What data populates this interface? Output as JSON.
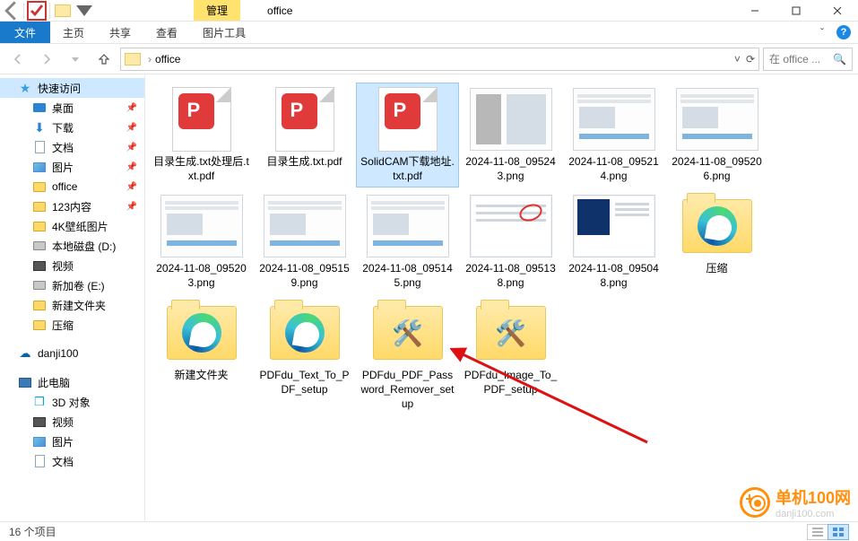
{
  "title_context_tab": "管理",
  "window_title": "office",
  "ribbon": {
    "file": "文件",
    "tabs": [
      "主页",
      "共享",
      "查看"
    ],
    "tool_tab": "图片工具"
  },
  "address": {
    "path_segments": [
      "office"
    ],
    "search_placeholder": "在 office ...",
    "search_icon_glyph": "🔍"
  },
  "sidebar": {
    "quick_access": "快速访问",
    "items_pinned": [
      {
        "label": "桌面",
        "icon": "desktop"
      },
      {
        "label": "下载",
        "icon": "download"
      },
      {
        "label": "文档",
        "icon": "doc"
      },
      {
        "label": "图片",
        "icon": "pic"
      },
      {
        "label": "office",
        "icon": "folder"
      },
      {
        "label": "123内容",
        "icon": "folder"
      }
    ],
    "items_recent": [
      {
        "label": "4K壁纸图片",
        "icon": "folder"
      },
      {
        "label": "本地磁盘 (D:)",
        "icon": "drive"
      },
      {
        "label": "视频",
        "icon": "video"
      },
      {
        "label": "新加卷 (E:)",
        "icon": "drive"
      },
      {
        "label": "新建文件夹",
        "icon": "folder"
      },
      {
        "label": "压缩",
        "icon": "folder"
      }
    ],
    "onedrive": "danji100",
    "this_pc": "此电脑",
    "pc_items": [
      {
        "label": "3D 对象",
        "icon": "3d"
      },
      {
        "label": "视频",
        "icon": "video"
      },
      {
        "label": "图片",
        "icon": "pic"
      },
      {
        "label": "文档",
        "icon": "doc"
      }
    ]
  },
  "files": [
    {
      "name": "PDFdu_Image_To_PDF_setup",
      "kind": "folder-exe"
    },
    {
      "name": "PDFdu_PDF_Password_Remover_setup",
      "kind": "folder-exe"
    },
    {
      "name": "PDFdu_Text_To_PDF_setup",
      "kind": "folder-edge"
    },
    {
      "name": "新建文件夹",
      "kind": "folder-edge"
    },
    {
      "name": "压缩",
      "kind": "folder-edge"
    },
    {
      "name": "2024-11-08_095048.png",
      "kind": "png-dark"
    },
    {
      "name": "2024-11-08_095138.png",
      "kind": "png-mark"
    },
    {
      "name": "2024-11-08_095145.png",
      "kind": "shot"
    },
    {
      "name": "2024-11-08_095159.png",
      "kind": "shot"
    },
    {
      "name": "2024-11-08_095203.png",
      "kind": "shot"
    },
    {
      "name": "2024-11-08_095206.png",
      "kind": "shot"
    },
    {
      "name": "2024-11-08_095214.png",
      "kind": "shot"
    },
    {
      "name": "2024-11-08_095243.png",
      "kind": "shot2"
    },
    {
      "name": "SolidCAM下载地址.txt.pdf",
      "kind": "pdf",
      "selected": true
    },
    {
      "name": "目录生成.txt.pdf",
      "kind": "pdf"
    },
    {
      "name": "目录生成.txt处理后.txt.pdf",
      "kind": "pdf"
    }
  ],
  "status": {
    "count_label": "16 个项目"
  },
  "watermark": {
    "brand": "单机100网",
    "site": "danji100.com"
  }
}
